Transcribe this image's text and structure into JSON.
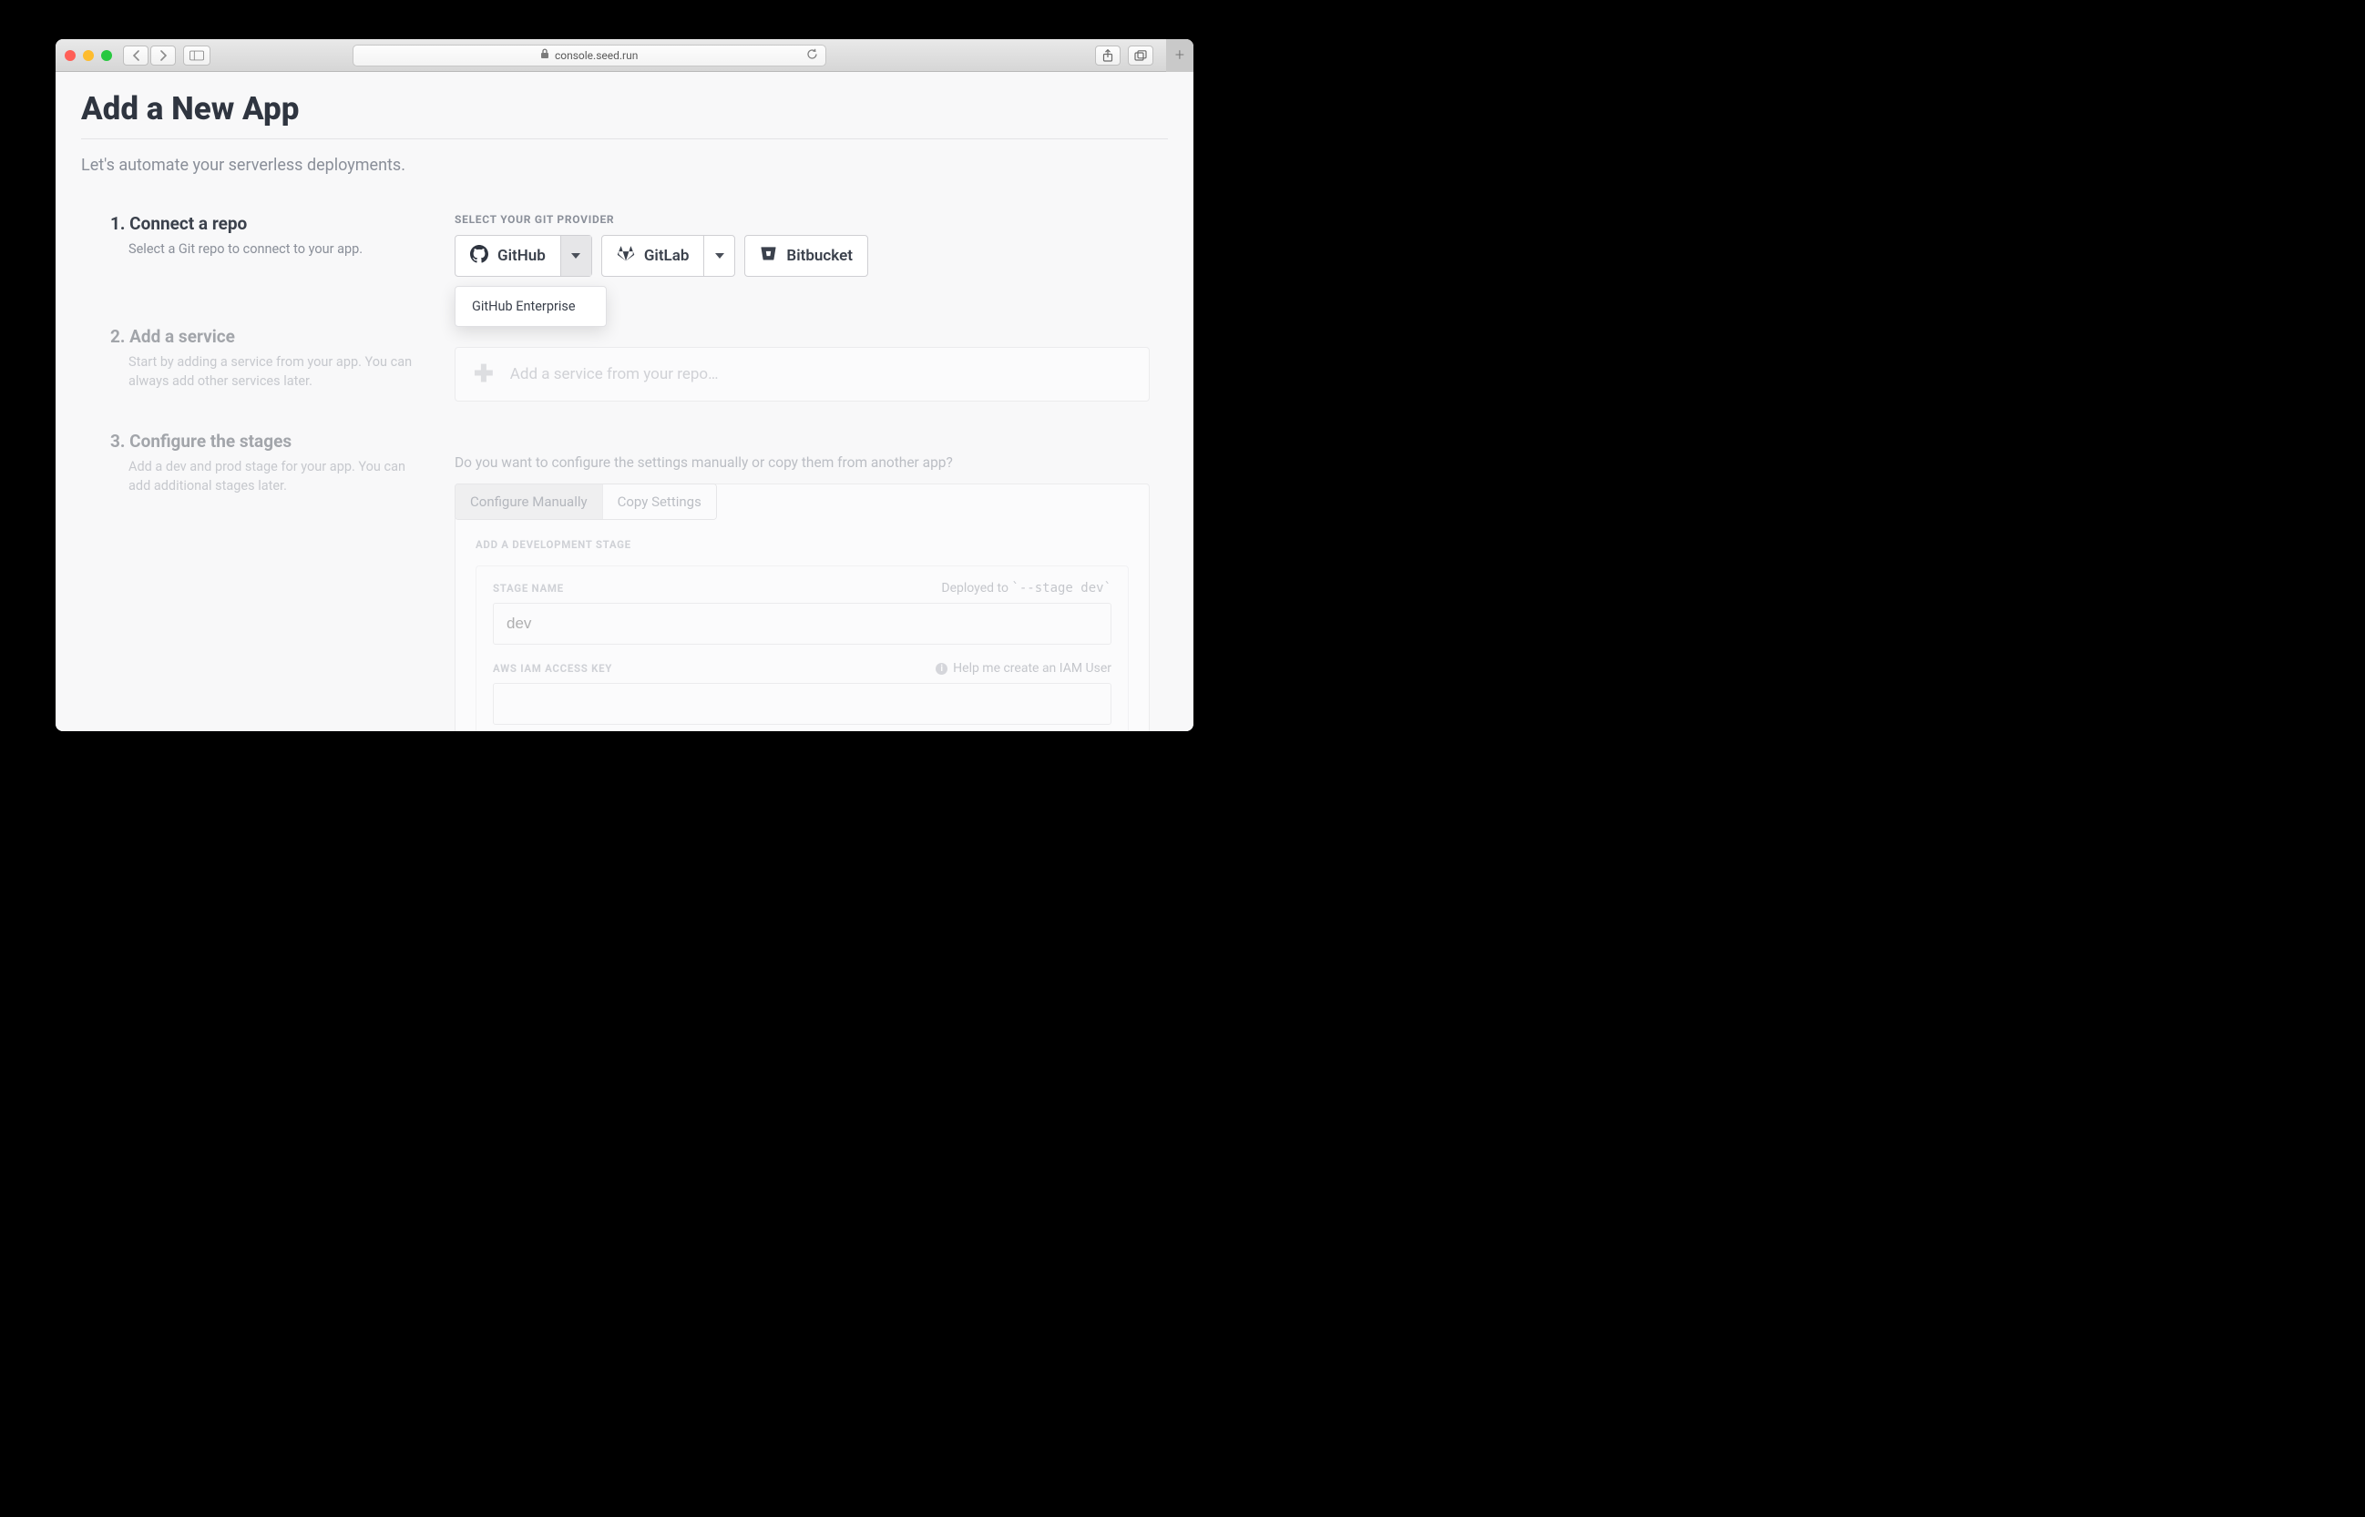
{
  "browser": {
    "url": "console.seed.run"
  },
  "page": {
    "title": "Add a New App",
    "subtitle": "Let's automate your serverless deployments."
  },
  "steps": {
    "s1": {
      "num": "1.",
      "title": "Connect a repo",
      "desc": "Select a Git repo to connect to your app."
    },
    "s2": {
      "num": "2.",
      "title": "Add a service",
      "desc": "Start by adding a service from your app. You can always add other services later."
    },
    "s3": {
      "num": "3.",
      "title": "Configure the stages",
      "desc": "Add a dev and prod stage for your app. You can add additional stages later."
    }
  },
  "git": {
    "label": "Select your Git provider",
    "github": "GitHub",
    "gitlab": "GitLab",
    "bitbucket": "Bitbucket",
    "dropdown_item": "GitHub Enterprise"
  },
  "add_service": {
    "placeholder": "Add a service from your repo…"
  },
  "configure": {
    "question": "Do you want to configure the settings manually or copy them from another app?",
    "tab_manual": "Configure Manually",
    "tab_copy": "Copy Settings",
    "dev_stage_label": "Add a development stage",
    "stage_name_label": "Stage Name",
    "deployed_to_prefix": "Deployed to ",
    "deployed_to_code": "`--stage dev`",
    "stage_name_placeholder": "dev",
    "iam_label": "AWS IAM Access Key",
    "iam_help": "Help me create an IAM User"
  }
}
